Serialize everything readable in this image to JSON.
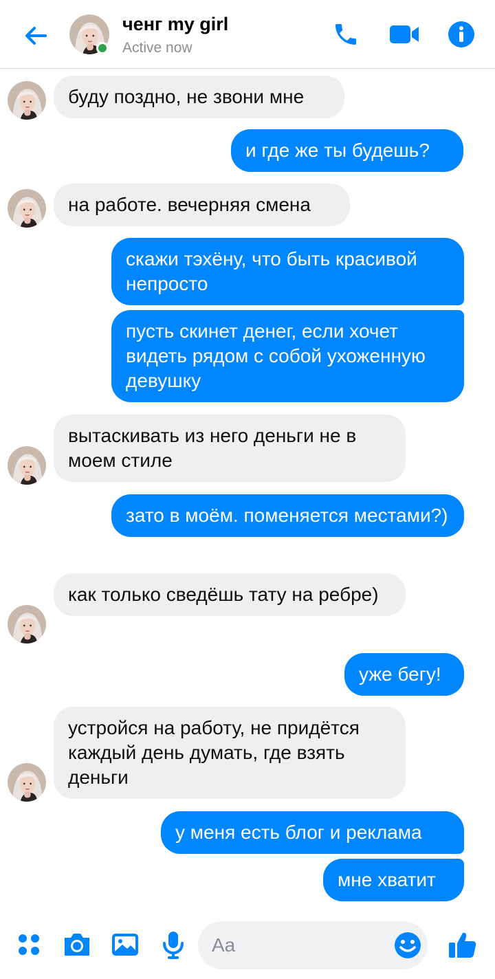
{
  "header": {
    "contact_name": "ченг my girl",
    "status": "Active now",
    "accent_color": "#0084ff",
    "online_color": "#31a24c",
    "icons": [
      "back-arrow-icon",
      "phone-icon",
      "video-camera-icon",
      "info-icon"
    ]
  },
  "messages": [
    {
      "direction": "incoming",
      "text": "буду поздно, не звони мне"
    },
    {
      "direction": "outgoing",
      "text": "и где же ты будешь?"
    },
    {
      "direction": "incoming",
      "text": "на работе. вечерняя смена"
    },
    {
      "direction": "outgoing",
      "text": "скажи тэхёну, что быть красивой непросто"
    },
    {
      "direction": "outgoing",
      "text": "пусть скинет денег, если хочет видеть рядом с собой ухоженную девушку"
    },
    {
      "direction": "incoming",
      "text": "вытаскивать из него деньги не в моем стиле"
    },
    {
      "direction": "outgoing",
      "text": "зато в моём. поменяется местами?)"
    },
    {
      "direction": "incoming",
      "text": "как только сведёшь тату на ребре)"
    },
    {
      "direction": "outgoing",
      "text": "уже бегу!"
    },
    {
      "direction": "incoming",
      "text": "устройся на работу, не придётся каждый день думать, где взять деньги"
    },
    {
      "direction": "outgoing",
      "text": "у меня есть блог и реклама"
    },
    {
      "direction": "outgoing",
      "text": "мне хватит"
    }
  ],
  "composer": {
    "placeholder": "Aa",
    "value": "",
    "icons": [
      "apps-grid-icon",
      "camera-icon",
      "gallery-icon",
      "microphone-icon",
      "emoji-icon",
      "thumbs-up-icon"
    ]
  },
  "colors": {
    "outgoing_bubble": "#0086ff",
    "incoming_bubble": "#efeff2"
  }
}
